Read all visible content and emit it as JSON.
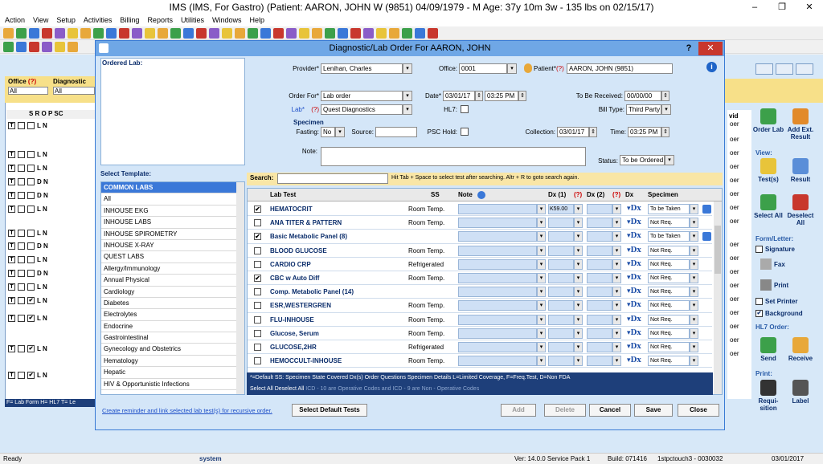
{
  "app": {
    "title": "IMS (IMS, For Gastro)    (Patient: AARON, JOHN W (9851) 04/09/1979 - M Age: 37y 10m 3w - 135 lbs on 02/15/17)",
    "window_controls": [
      "–",
      "❐",
      "✕"
    ]
  },
  "menu": [
    "Action",
    "View",
    "Setup",
    "Activities",
    "Billing",
    "Reports",
    "Utilities",
    "Windows",
    "Help"
  ],
  "background": {
    "office_label": "Office",
    "office_q": "(?)",
    "office_value": "All",
    "diag_label": "Diagnostic",
    "diag_value": "All",
    "columns": "S R O P  SC",
    "rows": [
      {
        "t": "T",
        "c1": "",
        "c2": "",
        "code": "L N"
      },
      {
        "t": "T",
        "c1": "",
        "c2": "",
        "code": "L N"
      },
      {
        "t": "T",
        "c1": "",
        "c2": "",
        "code": "L N"
      },
      {
        "t": "T",
        "c1": "",
        "c2": "",
        "code": "D N"
      },
      {
        "t": "T",
        "c1": "",
        "c2": "",
        "code": "D N"
      },
      {
        "t": "T",
        "c1": "",
        "c2": "",
        "code": "L N"
      },
      {
        "t": "T",
        "c1": "",
        "c2": "",
        "code": "L N"
      },
      {
        "t": "T",
        "c1": "",
        "c2": "",
        "code": "D N"
      },
      {
        "t": "T",
        "c1": "",
        "c2": "",
        "code": "L N"
      },
      {
        "t": "T",
        "c1": "",
        "c2": "",
        "code": "D N"
      },
      {
        "t": "T",
        "c1": "",
        "c2": "",
        "code": "L N"
      },
      {
        "t": "T",
        "c1": "",
        "c2": "✔",
        "code": "L N"
      },
      {
        "t": "T",
        "c1": "",
        "c2": "✔",
        "code": "L N"
      },
      {
        "t": "T",
        "c1": "",
        "c2": "✔",
        "code": "L N"
      },
      {
        "t": "T",
        "c1": "",
        "c2": "✔",
        "code": "L N"
      }
    ],
    "bottom_text": "F= Lab Form  H= HL7  T= Le",
    "vid_label": "vid",
    "oer_label": "oer"
  },
  "right_panel": {
    "order_lab": "Order Lab",
    "add_ext_result": "Add Ext. Result",
    "view_head": "View:",
    "tests": "Test(s)",
    "result": "Result",
    "select_all": "Select All",
    "deselect_all": "Deselect All",
    "form_letter_head": "Form/Letter:",
    "signature": "Signature",
    "fax": "Fax",
    "print": "Print",
    "set_printer": "Set Printer",
    "background": "Background",
    "hl7_order_head": "HL7 Order:",
    "send": "Send",
    "receive": "Receive",
    "print_head": "Print:",
    "requisition": "Requi-sition",
    "label": "Label"
  },
  "dialog": {
    "title": "Diagnostic/Lab Order For AARON, JOHN",
    "help": "?",
    "close": "✕",
    "ordered_lab_label": "Ordered Lab:",
    "provider_label": "Provider*",
    "provider_value": "Lenihan, Charles",
    "office_label": "Office:",
    "office_value": "0001",
    "patient_label": "Patient*",
    "patient_q": "(?)",
    "patient_value": "AARON, JOHN  (9851)",
    "order_for_label": "Order For*",
    "order_for_value": "Lab order",
    "date_label": "Date*",
    "date_value": "03/01/17",
    "time_value": "03:25 PM",
    "to_be_received_label": "To Be Received:",
    "to_be_received_value": "00/00/00",
    "lab_label": "Lab*",
    "lab_q": "(?)",
    "lab_value": "Quest Diagnostics",
    "hl7_label": "HL7:",
    "bill_type_label": "Bill Type:",
    "bill_type_value": "Third Party",
    "specimen_label": "Specimen",
    "fasting_label": "Fasting:",
    "fasting_value": "No",
    "source_label": "Source:",
    "psc_hold_label": "PSC Hold:",
    "collection_label": "Collection:",
    "collection_date": "03/01/17",
    "time_label": "Time:",
    "collection_time": "03:25 PM",
    "note_label": "Note:",
    "status_label": "Status:",
    "status_value": "To be Ordered",
    "select_template_label": "Select Template:",
    "templates": [
      "COMMON LABS",
      "All",
      "INHOUSE EKG",
      "INHOUSE LABS",
      "INHOUSE SPIROMETRY",
      "INHOUSE X-RAY",
      "QUEST LABS",
      "Allergy/Immunology",
      "Annual Physical",
      "Cardiology",
      "Diabetes",
      "Electrolytes",
      "Endocrine",
      "Gastrointestinal",
      "Gynecology and Obstetrics",
      "Hematology",
      "Hepatic",
      "HIV & Opportunistic Infections"
    ],
    "search_label": "Search:",
    "search_hint": "Hit Tab + Space to select test after searching. Altr + R to goto search again.",
    "grid_headers": {
      "lab_test": "Lab Test",
      "ss": "SS",
      "note": "Note",
      "dx1": "Dx (1)",
      "dx1_q": "(?)",
      "dx2": "Dx (2)",
      "dx2_q": "(?)",
      "dx": "Dx",
      "specimen": "Specimen"
    },
    "tests": [
      {
        "checked": "✔",
        "name": "HEMATOCRIT",
        "ss": "Room Temp.",
        "dx1": "K59.00",
        "spec": "To be Taken",
        "go": true
      },
      {
        "checked": "",
        "name": "ANA TITER & PATTERN",
        "ss": "Room Temp.",
        "dx1": "",
        "spec": "Not Req.",
        "go": false
      },
      {
        "checked": "✔",
        "name": "Basic Metabolic Panel (8)",
        "ss": "",
        "dx1": "",
        "spec": "To be Taken",
        "go": true
      },
      {
        "checked": "",
        "name": "BLOOD GLUCOSE",
        "ss": "Room Temp.",
        "dx1": "",
        "spec": "Not Req.",
        "go": false
      },
      {
        "checked": "",
        "name": "CARDIO CRP",
        "ss": "Refrigerated",
        "dx1": "",
        "spec": "Not Req.",
        "go": false
      },
      {
        "checked": "✔",
        "name": "CBC w Auto Diff",
        "ss": "Room Temp.",
        "dx1": "",
        "spec": "Not Req.",
        "go": false
      },
      {
        "checked": "",
        "name": "Comp. Metabolic Panel (14)",
        "ss": "",
        "dx1": "",
        "spec": "Not Req.",
        "go": false
      },
      {
        "checked": "",
        "name": "ESR,WESTERGREN",
        "ss": "Room Temp.",
        "dx1": "",
        "spec": "Not Req.",
        "go": false
      },
      {
        "checked": "",
        "name": "FLU-INHOUSE",
        "ss": "Room Temp.",
        "dx1": "",
        "spec": "Not Req.",
        "go": false
      },
      {
        "checked": "",
        "name": "Glucose, Serum",
        "ss": "Room Temp.",
        "dx1": "",
        "spec": "Not Req.",
        "go": false
      },
      {
        "checked": "",
        "name": "GLUCOSE,2HR",
        "ss": "Refrigerated",
        "dx1": "",
        "spec": "Not Req.",
        "go": false
      },
      {
        "checked": "",
        "name": "HEMOCCULT-INHOUSE",
        "ss": "Room Temp.",
        "dx1": "",
        "spec": "Not Req.",
        "go": false
      }
    ],
    "legend1": "*=Default   SS: Specimen State     Covered Dx(s)     Order Questions     Specimen Details    L=Limited Coverage, F=Freq.Test, D=Non FDA",
    "legend2_a": "  Select All     Deselect All",
    "legend2_b": "  ICD - 10 are Operative Codes and ICD - 9 are Non - Operative Codes",
    "link_text": "Create reminder and link selected lab test(s) for recursive order.",
    "select_default_tests": "Select Default Tests",
    "add": "Add",
    "delete": "Delete",
    "cancel": "Cancel",
    "save": "Save",
    "close_btn": "Close"
  },
  "statusbar": {
    "ready": "Ready",
    "user": "system",
    "version": "Ver: 14.0.0 Service Pack 1",
    "build": "Build: 071416",
    "station": "1stpctouch3 - 0030032",
    "date": "03/01/2017"
  },
  "colors": {
    "dialog_title": "#6fa7e6",
    "dialog_body": "#d4e6f8",
    "accent_blue": "#3a78d8",
    "navy": "#1e3f7a",
    "search_bar": "#f9e6a6",
    "close_red": "#c8372d"
  }
}
